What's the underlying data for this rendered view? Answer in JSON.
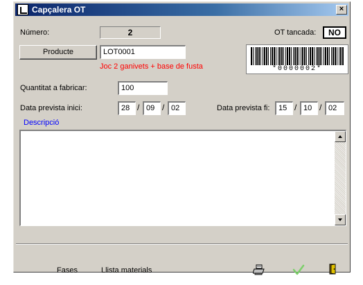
{
  "window": {
    "title": "Capçalera OT",
    "close_label": "×"
  },
  "form": {
    "numero_label": "Número:",
    "numero_value": "2",
    "ot_tancada_label": "OT tancada:",
    "ot_tancada_value": "NO",
    "producte_button": "Producte",
    "producte_value": "LOT0001",
    "producte_description": "Joc 2 ganivets + base de fusta",
    "barcode_text": "*0000002*",
    "quantitat_label": "Quantitat a fabricar:",
    "quantitat_value": "100",
    "data_inici_label": "Data prevista inici:",
    "data_inici": {
      "day": "28",
      "month": "09",
      "year": "02"
    },
    "data_fi_label": "Data prevista fi:",
    "data_fi": {
      "day": "15",
      "month": "10",
      "year": "02"
    },
    "date_separator": "/",
    "descripcio_label": "Descripció",
    "descripcio_value": ""
  },
  "footer": {
    "fases_label": "Fases",
    "llista_materials_label": "Llista materials",
    "print_icon": "printer-icon",
    "accept_icon": "checkmark-icon",
    "exit_icon": "exit-door-icon"
  },
  "colors": {
    "titlebar_start": "#0a246a",
    "titlebar_end": "#a6caf0",
    "description_red": "#ff0000",
    "descripcio_blue": "#0000ff",
    "window_face": "#d4d0c8"
  }
}
